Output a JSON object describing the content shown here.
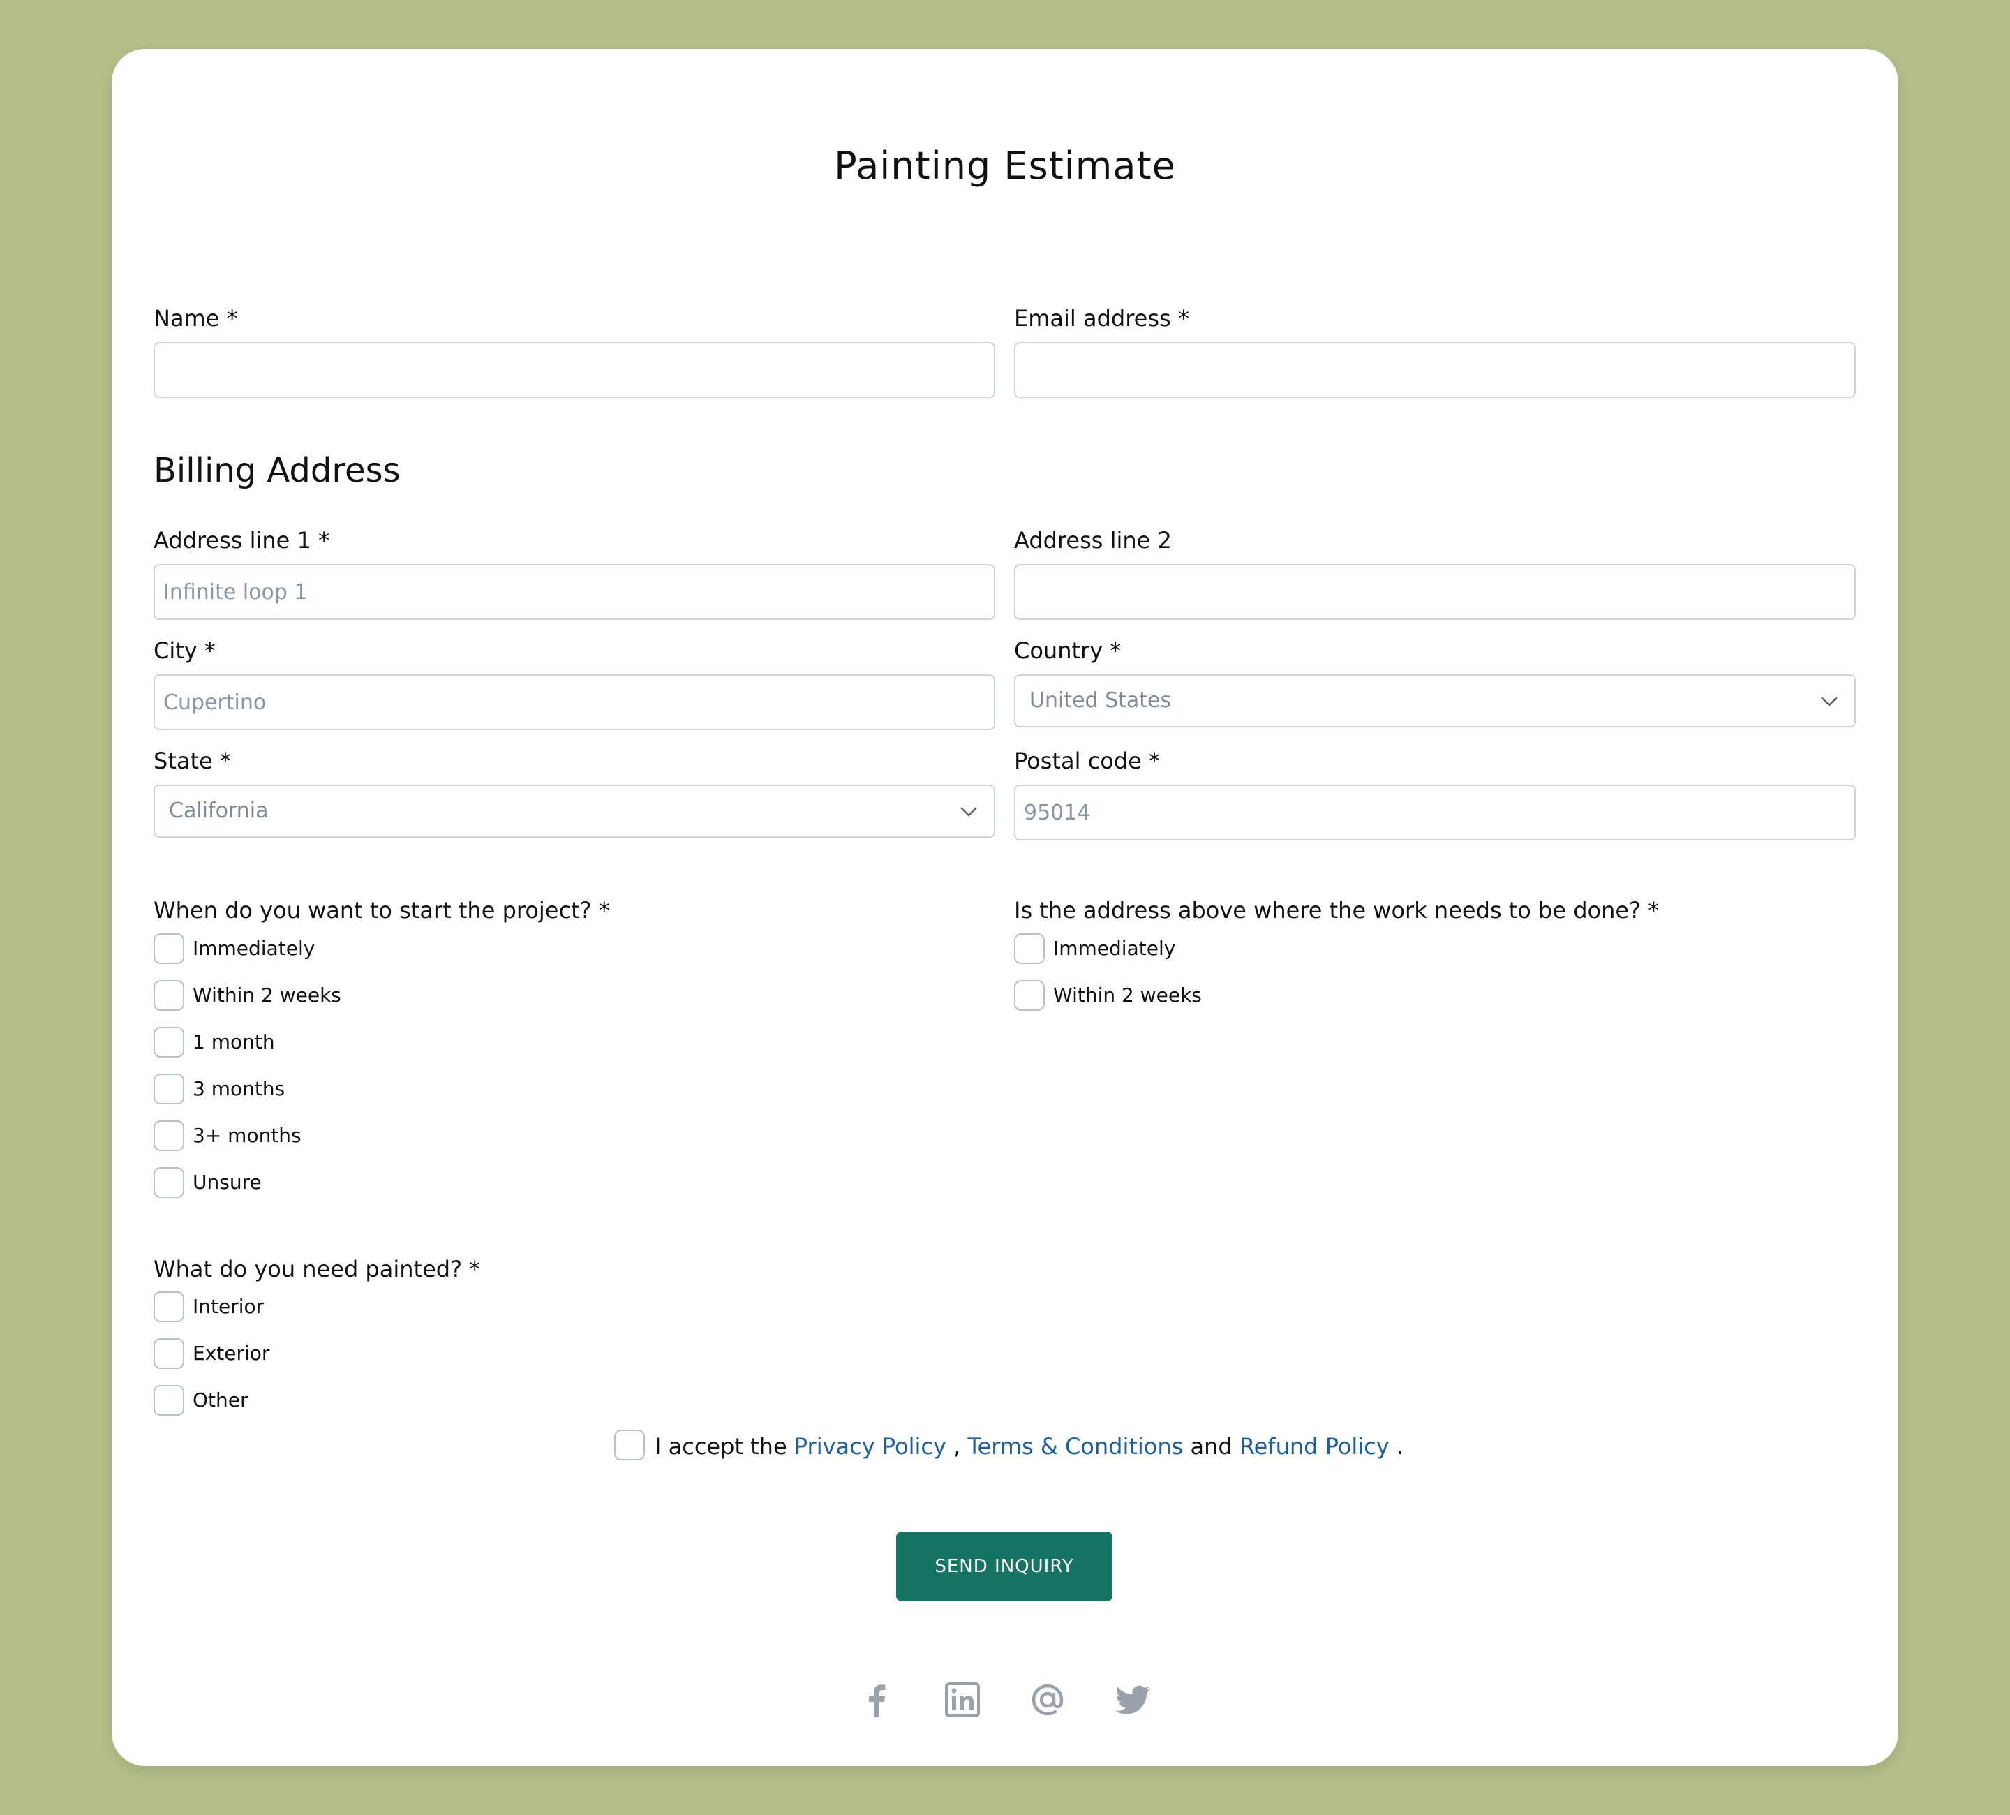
{
  "form": {
    "title": "Painting Estimate",
    "name_label": "Name *",
    "email_label": "Email address *",
    "billing_title": "Billing Address",
    "address1_label": "Address line 1 *",
    "address1_placeholder": "Infinite loop 1",
    "address2_label": "Address line 2",
    "city_label": "City *",
    "city_placeholder": "Cupertino",
    "country_label": "Country *",
    "country_value": "United States",
    "state_label": "State *",
    "state_value": "California",
    "postal_label": "Postal code *",
    "postal_placeholder": "95014",
    "start_question": "When do you want to start the project? *",
    "start_options": [
      "Immediately",
      "Within 2 weeks",
      "1 month",
      "3 months",
      "3+ months",
      "Unsure"
    ],
    "address_question": "Is the address above where the work needs to be done? *",
    "address_options": [
      "Immediately",
      "Within 2 weeks"
    ],
    "paint_question": "What do you need painted? *",
    "paint_options": [
      "Interior",
      "Exterior",
      "Other"
    ],
    "consent": {
      "prefix": "I accept the",
      "privacy": "Privacy Policy",
      "sep1": ",",
      "terms": "Terms & Conditions",
      "and": "and",
      "refund": "Refund Policy",
      "end": "."
    },
    "submit_label": "SEND INQUIRY"
  },
  "social": {
    "icons": [
      "facebook-icon",
      "linkedin-icon",
      "email-at-icon",
      "twitter-icon"
    ],
    "icon_color": "#9aa1ab"
  },
  "colors": {
    "background": "#b5bf89",
    "button": "#167464",
    "link": "#1a5f9e"
  }
}
